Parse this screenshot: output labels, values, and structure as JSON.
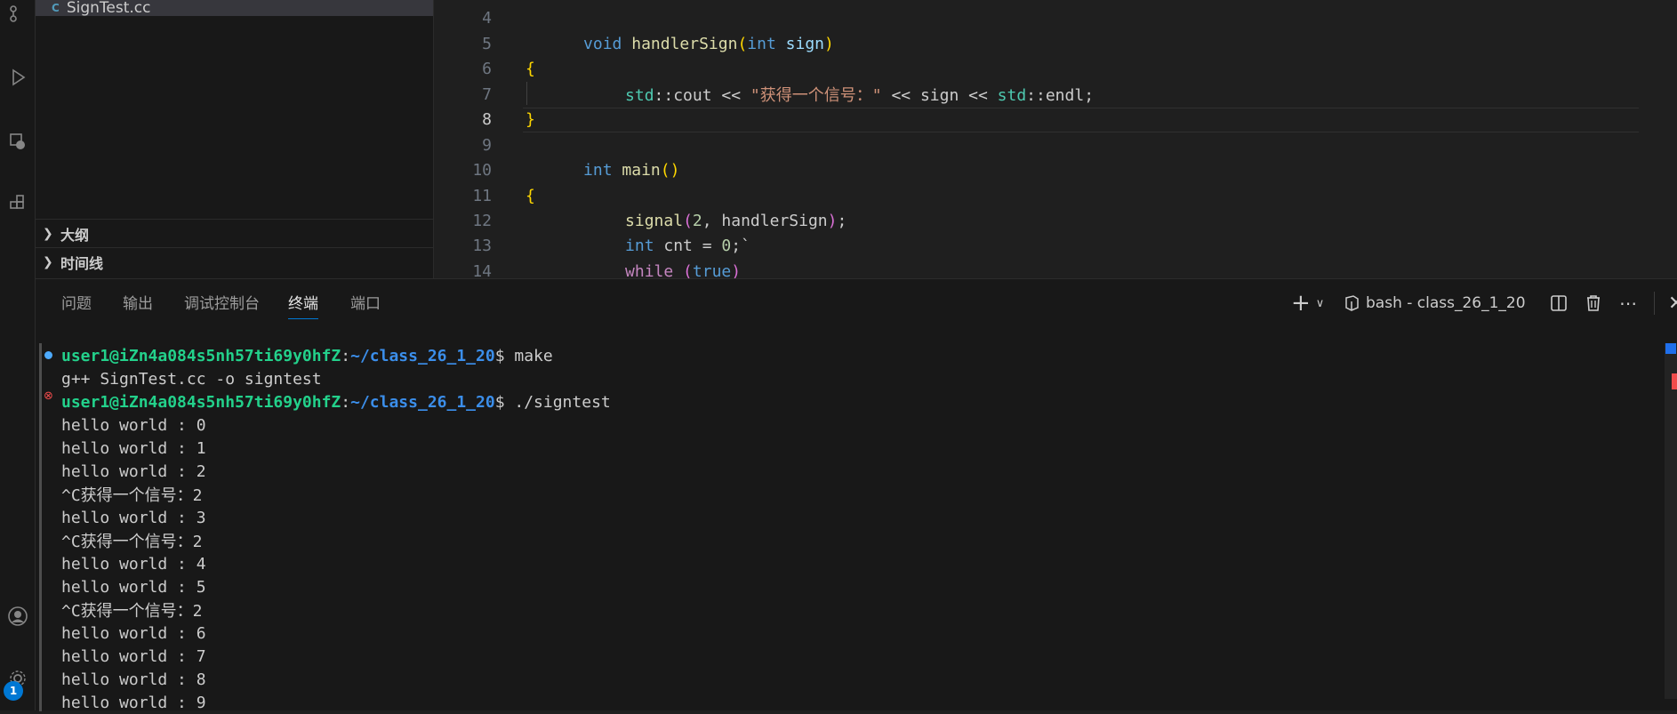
{
  "sidebar": {
    "open_file": "SignTest.cc",
    "open_file_icon": "C",
    "sections": [
      {
        "label": "大纲"
      },
      {
        "label": "时间线"
      }
    ]
  },
  "editor": {
    "lines": [
      {
        "num": "4"
      },
      {
        "num": "5"
      },
      {
        "num": "6"
      },
      {
        "num": "7"
      },
      {
        "num": "8"
      },
      {
        "num": "9"
      },
      {
        "num": "10"
      },
      {
        "num": "11"
      },
      {
        "num": "12"
      },
      {
        "num": "13"
      },
      {
        "num": "14"
      }
    ],
    "tokens": {
      "l5_void": "void",
      "l5_fn": "handlerSign",
      "l5_open": "(",
      "l5_int": "int",
      "l5_param": "sign",
      "l5_close": ")",
      "l6": "{",
      "l7_ns1": "std",
      "l7_cout": "::cout << ",
      "l7_str": "\"获得一个信号：\"",
      "l7_mid": " << sign << ",
      "l7_ns2": "std",
      "l7_endl": "::endl;",
      "l8": "}",
      "l10_int": "int",
      "l10_fn": "main",
      "l10_paren": "()",
      "l11": "{",
      "l12_fn": "signal",
      "l12_open": "(",
      "l12_num": "2",
      "l12_rest": ", handlerSign",
      "l12_close": ")",
      "l12_semi": ";",
      "l13_int": "int",
      "l13_mid": " cnt = ",
      "l13_num": "0",
      "l13_end": ";`",
      "l14_while": "while",
      "l14_open": " (",
      "l14_true": "true",
      "l14_close": ")"
    }
  },
  "panel": {
    "tabs": [
      {
        "label": "问题"
      },
      {
        "label": "输出"
      },
      {
        "label": "调试控制台"
      },
      {
        "label": "终端"
      },
      {
        "label": "端口"
      }
    ],
    "active_tab": "终端",
    "terminal_name": "bash - class_26_1_20"
  },
  "terminal": {
    "prompt_user": "user1@iZn4a084s5nh57ti69y0hfZ",
    "prompt_path": "~/class_26_1_20",
    "prompt_colon": ":",
    "prompt_dollar": "$",
    "cmd1": " make",
    "out1": "g++ SignTest.cc -o signtest",
    "cmd2": " ./signtest",
    "output": [
      "hello world : 0",
      "hello world : 1",
      "hello world : 2",
      "^C获得一个信号：2",
      "hello world : 3",
      "^C获得一个信号：2",
      "hello world : 4",
      "hello world : 5",
      "^C获得一个信号：2",
      "hello world : 6",
      "hello world : 7",
      "hello world : 8",
      "hello world : 9"
    ]
  },
  "activity": {
    "notification_count": "1"
  }
}
